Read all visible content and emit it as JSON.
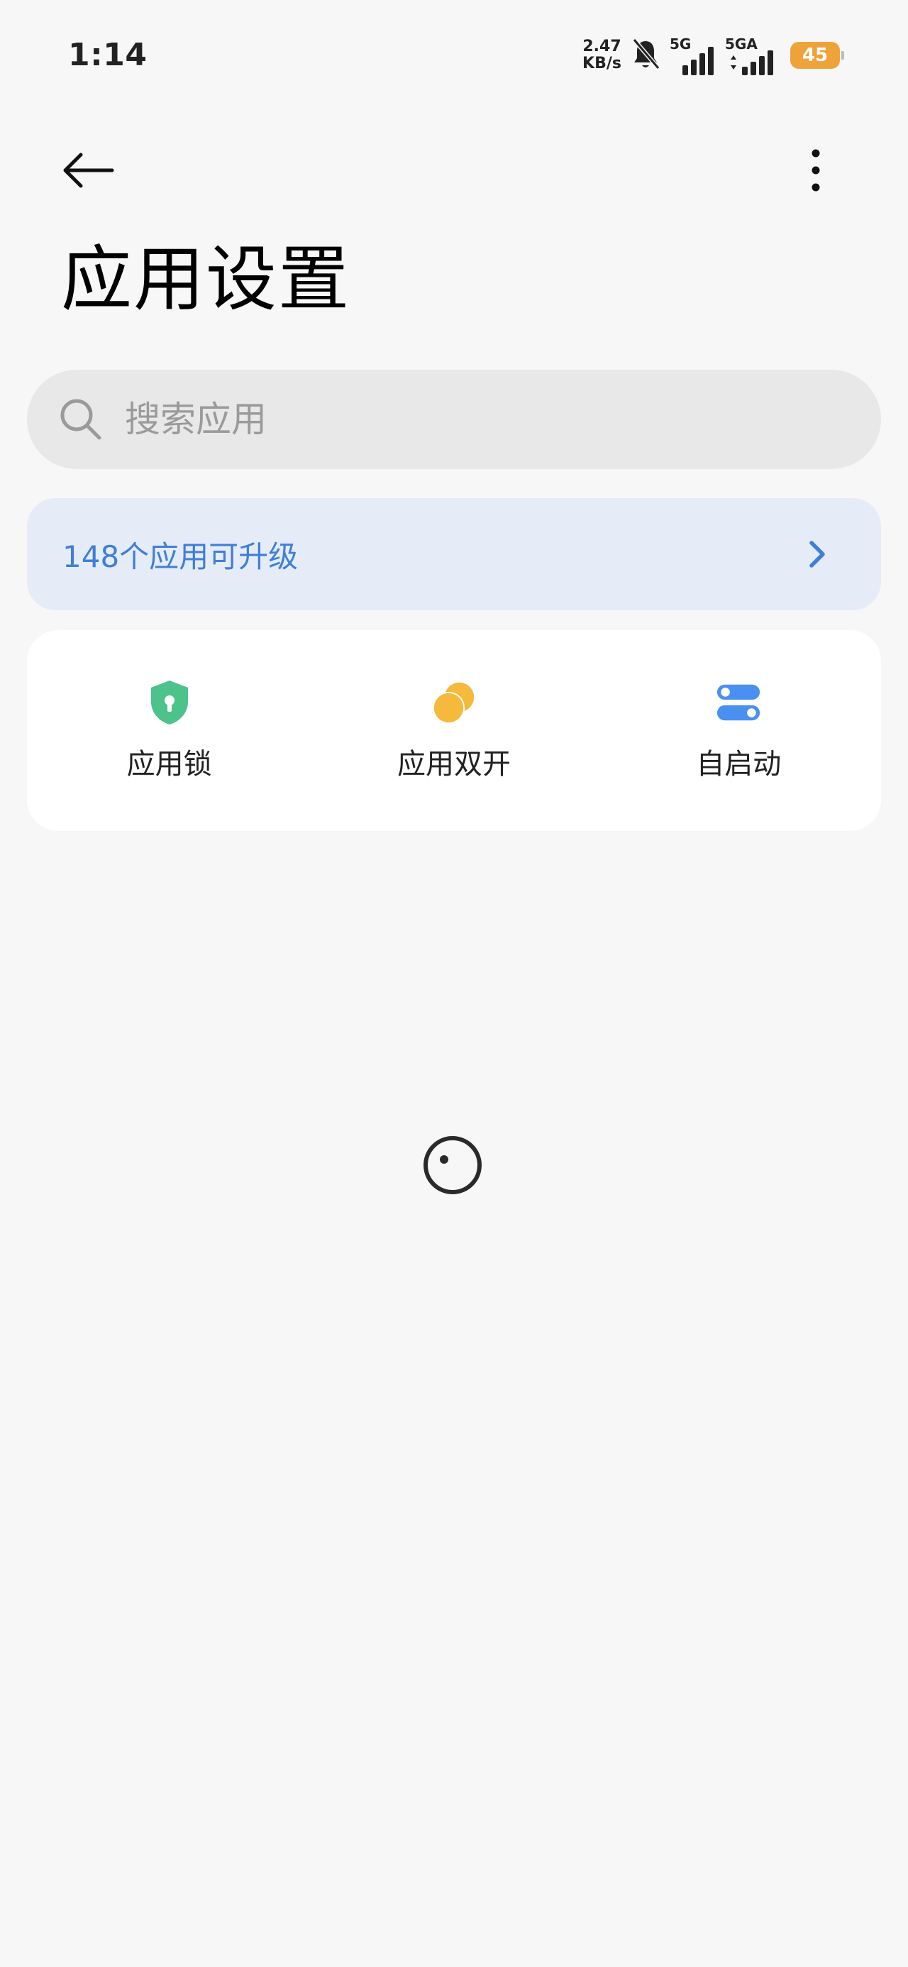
{
  "status_bar": {
    "time": "1:14",
    "net_speed_value": "2.47",
    "net_speed_unit": "KB/s",
    "sim1_label": "5G",
    "sim2_label": "5GA",
    "battery_level": "45",
    "battery_color": "#f0a23a"
  },
  "header": {
    "back_icon": "arrow-left-icon",
    "more_icon": "more-vertical-icon",
    "title": "应用设置"
  },
  "search": {
    "placeholder": "搜索应用",
    "icon": "search-icon"
  },
  "upgrade_banner": {
    "text": "148个应用可升级",
    "accent_color": "#3f7fd7",
    "background": "#e6ecf7"
  },
  "shortcuts": [
    {
      "label": "应用锁",
      "icon": "shield-lock-icon",
      "color": "#4cc38a"
    },
    {
      "label": "应用双开",
      "icon": "dual-app-icon",
      "color": "#f5b93b"
    },
    {
      "label": "自启动",
      "icon": "toggle-autostart-icon",
      "color": "#4a90f0"
    }
  ]
}
